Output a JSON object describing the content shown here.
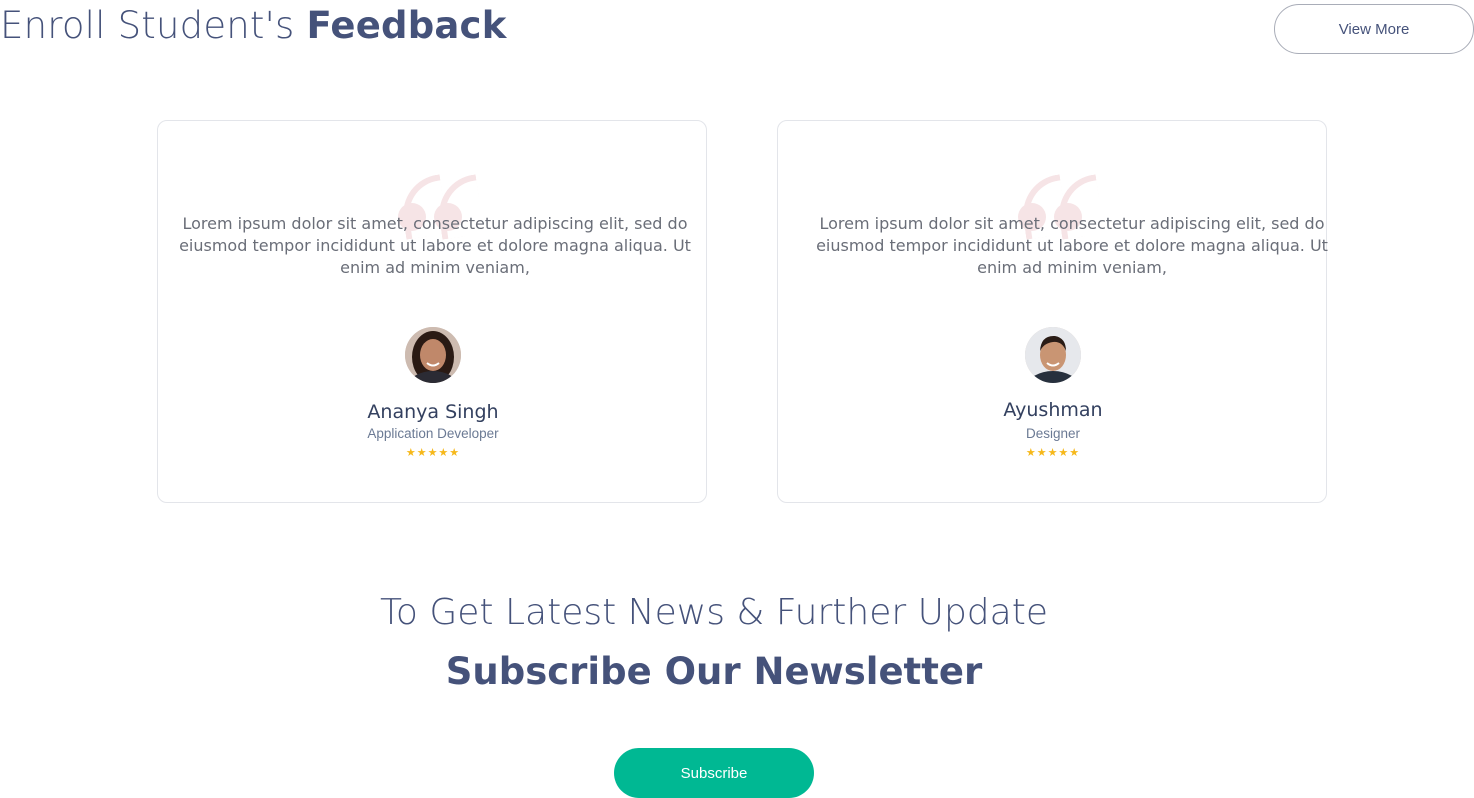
{
  "header": {
    "title_light": "Enroll Student's ",
    "title_bold": "Feedback",
    "view_more_label": "View More"
  },
  "testimonials": [
    {
      "review": "Lorem ipsum dolor sit amet, consectetur adipiscing elit, sed do eiusmod tempor incididunt ut labore et dolore magna aliqua. Ut enim ad minim veniam,",
      "name": "Ananya Singh",
      "role": "Application Developer",
      "stars": "★★★★★",
      "rating": 5
    },
    {
      "review": "Lorem ipsum dolor sit amet, consectetur adipiscing elit, sed do eiusmod tempor incididunt ut labore et dolore magna aliqua. Ut enim ad minim veniam,",
      "name": "Ayushman",
      "role": "Designer",
      "stars": "★★★★★",
      "rating": 5
    }
  ],
  "newsletter": {
    "line": "To Get Latest News & Further Update",
    "title": "Subscribe Our Newsletter",
    "button_label": "Subscribe"
  },
  "colors": {
    "heading": "#45527a",
    "accent_green": "#00b893",
    "star": "#f6b81a",
    "quote_mark": "#f6e4e6"
  }
}
